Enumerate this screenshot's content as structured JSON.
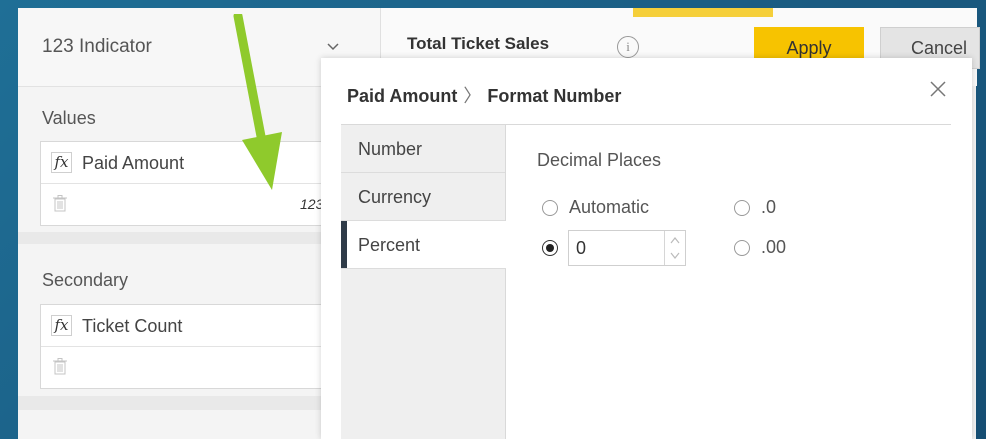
{
  "left_panel": {
    "viz_type": "123  Indicator",
    "values_label": "Values",
    "values_field": "Paid Amount",
    "values_format": "123",
    "secondary_label": "Secondary",
    "secondary_field": "Ticket Count",
    "fx_symbol": "fx"
  },
  "toolbar": {
    "title": "Total Ticket Sales",
    "info_symbol": "i",
    "apply_label": "Apply",
    "cancel_label": "Cancel"
  },
  "dialog": {
    "crumb_parent": "Paid Amount",
    "crumb_sep": "〉",
    "crumb_current": "Format Number",
    "tabs": [
      {
        "label": "Number"
      },
      {
        "label": "Currency"
      },
      {
        "label": "Percent"
      }
    ],
    "active_tab": "Percent",
    "decimal_label": "Decimal Places",
    "options": {
      "automatic": "Automatic",
      "one": ".0",
      "two": ".00",
      "custom_value": "0"
    },
    "selected_option": "custom"
  },
  "colors": {
    "apply": "#f7c300",
    "accent_tab": "#2f3b48",
    "arrow": "#8fca2c"
  }
}
